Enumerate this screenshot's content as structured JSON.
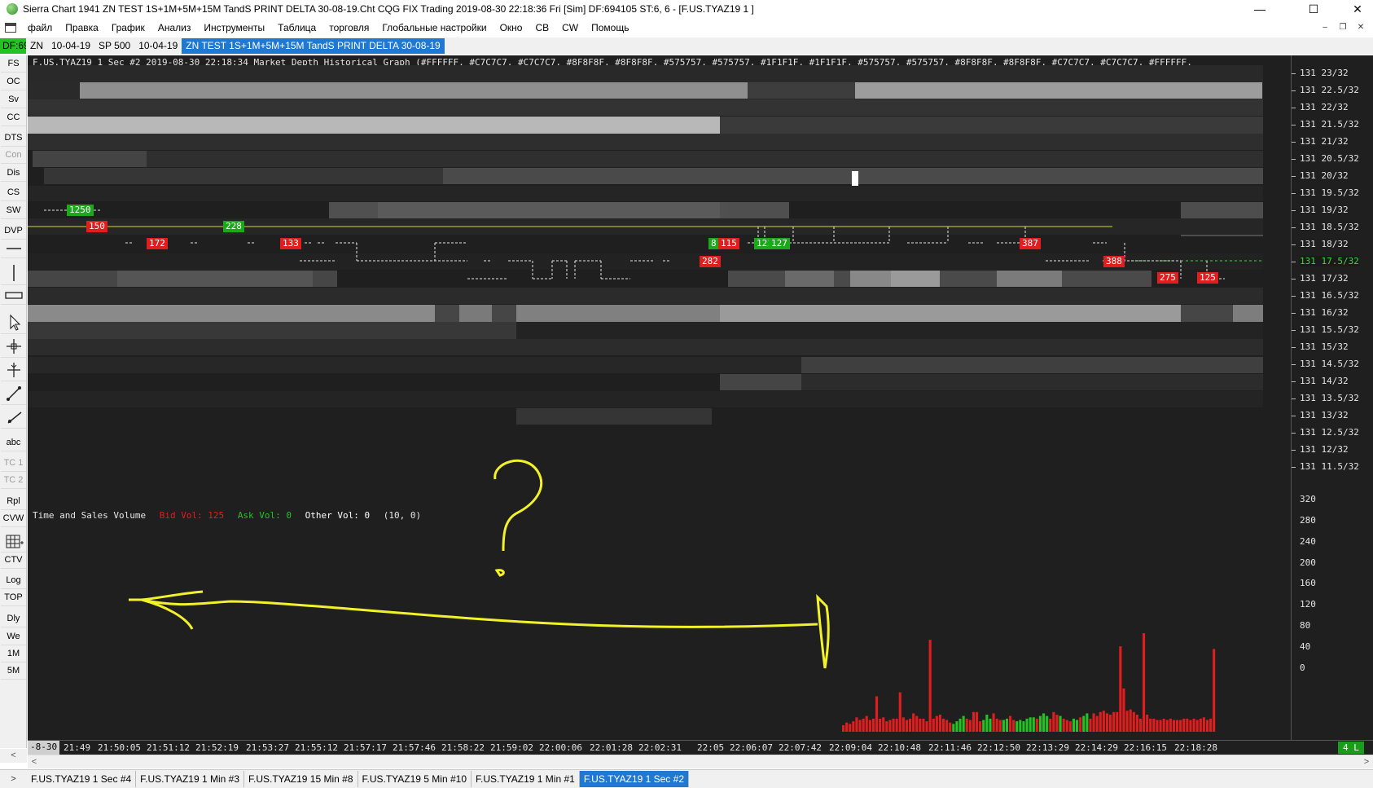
{
  "window": {
    "title": "Sierra Chart 1941 ZN TEST 1S+1M+5M+15M TandS  PRINT DELTA  30-08-19.Cht  CQG FIX Trading 2019-08-30  22:18:36 Fri [Sim]  DF:694105  ST:6, 6 - [F.US.TYAZ19  1 ]",
    "minimize_icon": "minimize-icon",
    "maximize_icon": "maximize-icon",
    "close_icon": "close-icon"
  },
  "menu": {
    "items": [
      "файл",
      "Правка",
      "График",
      "Анализ",
      "Инструменты",
      "Таблица",
      "торговля",
      "Глобальные настройки",
      "Окно",
      "CB",
      "CW",
      "Помощь"
    ]
  },
  "chartbook_tabs": {
    "df_indicator": "DF:69",
    "tabs": [
      "ZN",
      "10-04-19",
      "SP 500",
      "10-04-19",
      "ZN TEST 1S+1M+5M+15M TandS  PRINT DELTA  30-08-19"
    ],
    "active_index": 4
  },
  "toolbar": {
    "buttons": [
      {
        "label": "FS",
        "dim": false
      },
      {
        "label": "OC",
        "dim": false
      },
      {
        "label": "Sv",
        "dim": false
      },
      {
        "label": "CC",
        "dim": false
      },
      {
        "label": "DTS",
        "dim": false
      },
      {
        "label": "Con",
        "dim": true
      },
      {
        "label": "Dis",
        "dim": false
      },
      {
        "label": "CS",
        "dim": false
      },
      {
        "label": "SW",
        "dim": false
      },
      {
        "label": "DVP",
        "dim": false
      }
    ],
    "tools_icons": [
      "horizontal-line-icon",
      "vertical-line-icon",
      "rectangle-icon",
      "pointer-icon",
      "crosshair-icon",
      "cursor-icon",
      "line-tool-icon",
      "ray-tool-icon"
    ],
    "text_tool": "abc",
    "buttons2": [
      {
        "label": "TC 1",
        "dim": true
      },
      {
        "label": "TC 2",
        "dim": true
      },
      {
        "label": "Rpl",
        "dim": false
      },
      {
        "label": "CVW",
        "dim": false
      }
    ],
    "trade_window_icon": "trade-window-icon",
    "buttons3": [
      "CTV",
      "Log",
      "TOP",
      "Dly",
      "We",
      "1M",
      "5M"
    ],
    "scroll_left": "<"
  },
  "chart": {
    "header": "F.US.TYAZ19   1 Sec    #2 2019-08-30 22:18:34 Market Depth Historical Graph   (#FFFFFF, #C7C7C7, #C7C7C7, #8F8F8F, #8F8F8F, #575757, #575757, #1F1F1F, #1F1F1F, #575757, #575757, #8F8F8F, #8F8F8F, #C7C7C7, #C7C7C7, #FFFFFF,",
    "price_labels": [
      "131 23/32",
      "131 22.5/32",
      "131 22/32",
      "131 21.5/32",
      "131 21/32",
      "131 20.5/32",
      "131 20/32",
      "131 19.5/32",
      "131 19/32",
      "131 18.5/32",
      "131 18/32",
      "131 17.5/32",
      "131 17/32",
      "131 16.5/32",
      "131 16/32",
      "131 15.5/32",
      "131 15/32",
      "131 14.5/32",
      "131 14/32",
      "131 13.5/32",
      "131 13/32",
      "131 12.5/32",
      "131 12/32",
      "131 11.5/32"
    ],
    "current_price_index": 11,
    "trade_labels": [
      {
        "text": "1250",
        "side": "ask"
      },
      {
        "text": "150",
        "side": "bid"
      },
      {
        "text": "228",
        "side": "ask"
      },
      {
        "text": "172",
        "side": "bid"
      },
      {
        "text": "133",
        "side": "bid"
      },
      {
        "text": "282",
        "side": "bid"
      },
      {
        "text": "8",
        "side": "ask"
      },
      {
        "text": "115",
        "side": "bid"
      },
      {
        "text": "121",
        "side": "ask"
      },
      {
        "text": "127",
        "side": "ask"
      },
      {
        "text": "387",
        "side": "bid"
      },
      {
        "text": "388",
        "side": "bid"
      },
      {
        "text": "275",
        "side": "bid"
      },
      {
        "text": "125",
        "side": "bid"
      }
    ],
    "tsv": {
      "title": "Time and Sales Volume",
      "bid": "Bid Vol: 125",
      "ask": "Ask Vol: 0",
      "other": "Other Vol: 0",
      "params": "(10, 0)"
    },
    "volume_labels": [
      "320",
      "280",
      "240",
      "200",
      "160",
      "120",
      "80",
      "40",
      "0"
    ],
    "colors": {
      "bid": "#e01e1e",
      "ask": "#1ba81b",
      "annotation": "#f2f22a",
      "price_line": "#d8d82a"
    }
  },
  "time_axis": {
    "start": "-8-30",
    "labels": [
      "21:49",
      "21:50:05",
      "21:51:12",
      "21:52:19",
      "21:53:27",
      "21:55:12",
      "21:57:17",
      "21:57:46",
      "21:58:22",
      "21:59:02",
      "22:00:06",
      "22:01:28",
      "22:02:31",
      "22:05",
      "22:06:07",
      "22:07:42",
      "22:09:04",
      "22:10:48",
      "22:11:46",
      "22:12:50",
      "22:13:29",
      "22:14:29",
      "22:16:15",
      "22:18:28"
    ],
    "status": "4 L"
  },
  "scroll": {
    "left": "<",
    "right": ">"
  },
  "bottom_tabs": {
    "arrow": ">",
    "tabs": [
      "F.US.TYAZ19  1 Sec   #4",
      "F.US.TYAZ19  1 Min   #3",
      "F.US.TYAZ19  15 Min   #8",
      "F.US.TYAZ19  5 Min   #10",
      "F.US.TYAZ19  1 Min   #1",
      "F.US.TYAZ19  1 Sec   #2"
    ],
    "active_index": 5
  }
}
